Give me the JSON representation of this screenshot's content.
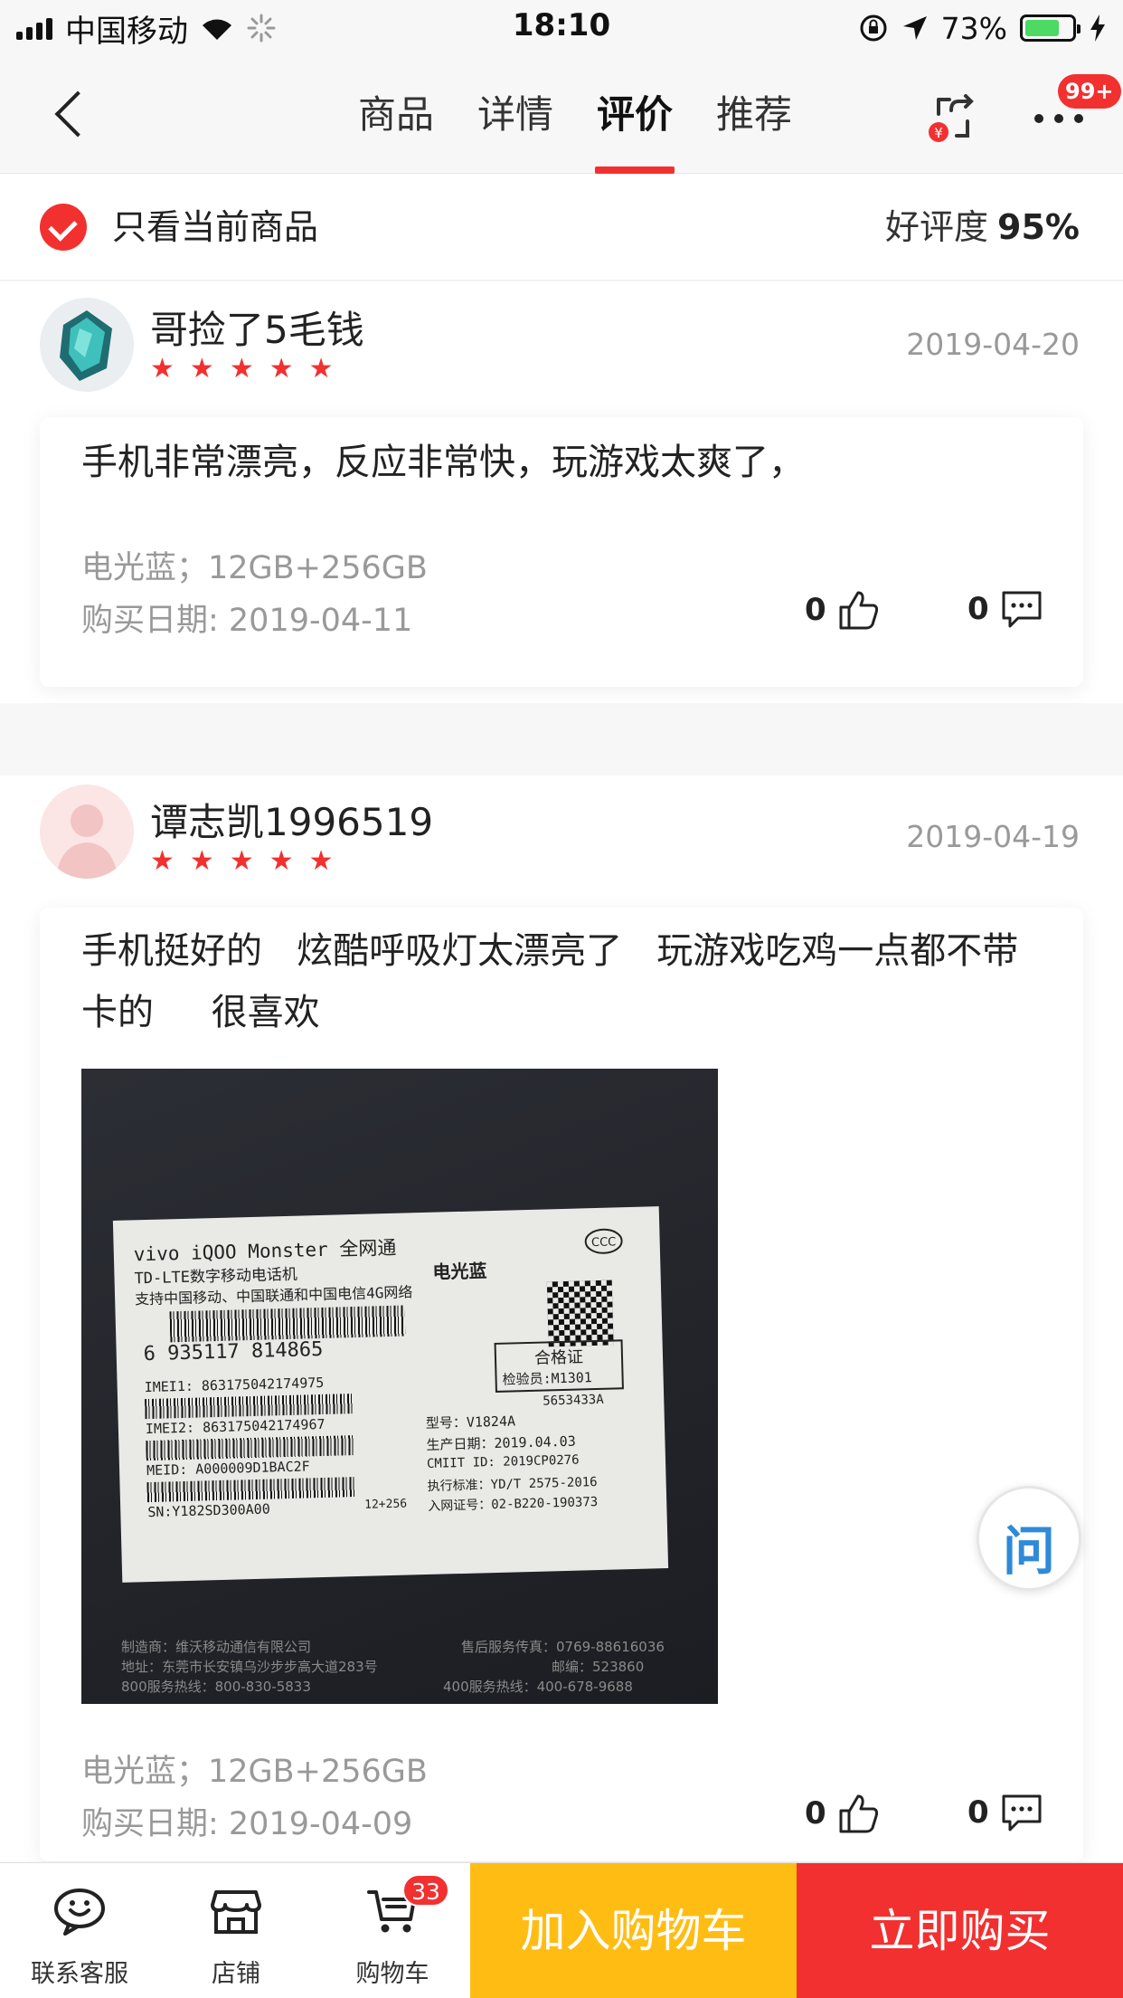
{
  "status_bar": {
    "carrier": "中国移动",
    "time": "18:10",
    "battery": "73%",
    "battery_level": 0.73
  },
  "nav": {
    "tabs": [
      "商品",
      "详情",
      "评价",
      "推荐"
    ],
    "active_tab": "评价",
    "more_badge": "99+"
  },
  "filter": {
    "label": "只看当前商品",
    "rating_label": "好评度",
    "rating_value": "95%"
  },
  "reviews": [
    {
      "username": "哥捡了5毛钱",
      "stars": 5,
      "date": "2019-04-20",
      "text": "手机非常漂亮，反应非常快，玩游戏太爽了，",
      "variant": "电光蓝；12GB+256GB",
      "purchase_date": "购买日期: 2019-04-11",
      "likes": "0",
      "comments": "0"
    },
    {
      "username": "谭志凯1996519",
      "stars": 5,
      "date": "2019-04-19",
      "text": "手机挺好的   炫酷呼吸灯太漂亮了   玩游戏吃鸡一点都不带卡的     很喜欢",
      "photo_label": {
        "line1": "vivo iQOO Monster 全网通",
        "line2": "TD-LTE数字移动电话机",
        "color": "电光蓝",
        "line3": "支持中国移动、中国联通和中国电信4G网络",
        "ean": "6   935117  814865",
        "imei1": "IMEI1: 863175042174975",
        "imei2": "IMEI2: 863175042174967",
        "meid": "MEID: A000009D1BAC2F",
        "sn": "SN:Y182SD300A00",
        "spec": "12+256",
        "cert_title": "合格证",
        "inspector": "检验员:M1301",
        "cert_no": "5653433A",
        "model": "型号：V1824A",
        "prod_date": "生产日期：2019.04.03",
        "cmiit": "CMIIT  ID: 2019CP0276",
        "standard": "执行标准：YD/T 2575-2016",
        "network_cert": "入网证号：02-B220-190373",
        "maker": "制造商：维沃移动通信有限公司",
        "address": "地址：东莞市长安镇乌沙步步高大道283号",
        "hotline800": "800服务热线：800-830-5833",
        "service_tel": "售后服务传真：0769-88616036",
        "postcode": "邮编：523860",
        "hotline400": "400服务热线：400-678-9688"
      },
      "variant": "电光蓝；12GB+256GB",
      "purchase_date": "购买日期: 2019-04-09",
      "likes": "0",
      "comments": "0"
    }
  ],
  "float_button": "问",
  "bottom_bar": {
    "service": "联系客服",
    "store": "店铺",
    "cart": "购物车",
    "cart_count": "33",
    "add_to_cart": "加入购物车",
    "buy_now": "立即购买"
  },
  "colors": {
    "accent": "#f23030",
    "add_cart": "#ffbd14",
    "battery": "#4cd964"
  }
}
